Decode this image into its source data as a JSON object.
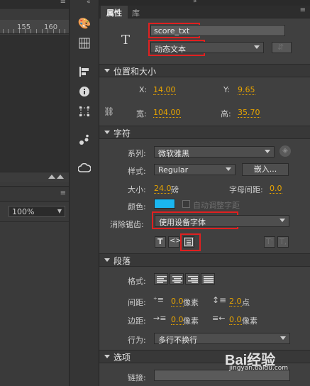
{
  "ruler": {
    "tick_155": "155",
    "tick_160": "160"
  },
  "zoom": {
    "value": "100%"
  },
  "tabs": {
    "properties": "属性",
    "library": "库"
  },
  "instance": {
    "name": "score_txt",
    "text_type": "动态文本"
  },
  "position_size": {
    "title": "位置和大小",
    "x_label": "X:",
    "x_value": "14.00",
    "y_label": "Y:",
    "y_value": "9.65",
    "width_label": "宽:",
    "width_value": "104.00",
    "height_label": "高:",
    "height_value": "35.70"
  },
  "character": {
    "title": "字符",
    "family_label": "系列:",
    "family_value": "微软雅黑",
    "style_label": "样式:",
    "style_value": "Regular",
    "embed_button": "嵌入...",
    "size_label": "大小:",
    "size_value": "24.0",
    "size_unit": "磅",
    "letter_spacing_label": "字母间距:",
    "letter_spacing_value": "0.0",
    "color_label": "颜色:",
    "color_value": "#1ab6f0",
    "auto_kern_label": "自动调整字距",
    "anti_alias_label": "消除锯齿:",
    "anti_alias_value": "使用设备字体"
  },
  "paragraph": {
    "title": "段落",
    "format_label": "格式:",
    "spacing_label": "间距:",
    "indent_value": "0.0",
    "indent_unit": "像素",
    "line_spacing_value": "2.0",
    "line_spacing_unit": "点",
    "margin_label": "边距:",
    "left_margin_value": "0.0",
    "left_margin_unit": "像素",
    "right_margin_value": "0.0",
    "right_margin_unit": "像素",
    "behavior_label": "行为:",
    "behavior_value": "多行不换行"
  },
  "options": {
    "title": "选项",
    "link_label": "链接:"
  },
  "watermark": {
    "brand": "Bai经验",
    "url": "jingyan.baidu.com"
  },
  "colors": {
    "highlight": "#e02020",
    "value": "#e8a400",
    "swatch": "#1ab6f0"
  }
}
